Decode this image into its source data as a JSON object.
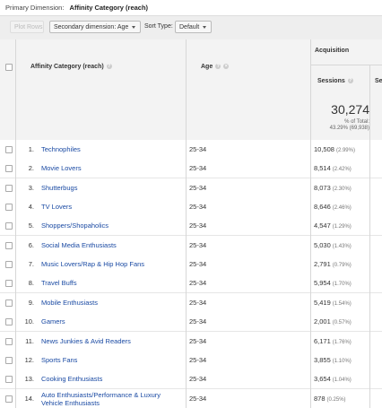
{
  "primary_dimension": {
    "label": "Primary Dimension:",
    "value": "Affinity Category (reach)"
  },
  "toolbar": {
    "plot_rows": "Plot Rows",
    "secondary_dimension": "Secondary dimension: Age",
    "sort_type_label": "Sort Type:",
    "sort_type_value": "Default"
  },
  "table": {
    "group_header": "Acquisition",
    "col_category": "Affinity Category (reach)",
    "col_age": "Age",
    "col_sessions": "Sessions",
    "col_next_partial": "Se",
    "total": {
      "value": "30,274",
      "pct_label": "% of Total:",
      "pct_value": "43.29% (69,938)"
    },
    "rows": [
      {
        "rank": "1.",
        "category": "Technophiles",
        "age": "25-34",
        "sessions": "10,508",
        "pct": "(2.99%)"
      },
      {
        "rank": "2.",
        "category": "Movie Lovers",
        "age": "25-34",
        "sessions": "8,514",
        "pct": "(2.42%)"
      },
      {
        "rank": "3.",
        "category": "Shutterbugs",
        "age": "25-34",
        "sessions": "8,073",
        "pct": "(2.30%)"
      },
      {
        "rank": "4.",
        "category": "TV Lovers",
        "age": "25-34",
        "sessions": "8,646",
        "pct": "(2.46%)"
      },
      {
        "rank": "5.",
        "category": "Shoppers/Shopaholics",
        "age": "25-34",
        "sessions": "4,547",
        "pct": "(1.29%)"
      },
      {
        "rank": "6.",
        "category": "Social Media Enthusiasts",
        "age": "25-34",
        "sessions": "5,030",
        "pct": "(1.43%)"
      },
      {
        "rank": "7.",
        "category": "Music Lovers/Rap & Hip Hop Fans",
        "age": "25-34",
        "sessions": "2,791",
        "pct": "(0.79%)"
      },
      {
        "rank": "8.",
        "category": "Travel Buffs",
        "age": "25-34",
        "sessions": "5,954",
        "pct": "(1.70%)"
      },
      {
        "rank": "9.",
        "category": "Mobile Enthusiasts",
        "age": "25-34",
        "sessions": "5,419",
        "pct": "(1.54%)"
      },
      {
        "rank": "10.",
        "category": "Gamers",
        "age": "25-34",
        "sessions": "2,001",
        "pct": "(0.57%)"
      },
      {
        "rank": "11.",
        "category": "News Junkies & Avid Readers",
        "age": "25-34",
        "sessions": "6,171",
        "pct": "(1.76%)"
      },
      {
        "rank": "12.",
        "category": "Sports Fans",
        "age": "25-34",
        "sessions": "3,855",
        "pct": "(1.10%)"
      },
      {
        "rank": "13.",
        "category": "Cooking Enthusiasts",
        "age": "25-34",
        "sessions": "3,654",
        "pct": "(1.04%)"
      },
      {
        "rank": "14.",
        "category": "Auto Enthusiasts/Performance & Luxury Vehicle Enthusiasts",
        "age": "25-34",
        "sessions": "878",
        "pct": "(0.25%)"
      }
    ]
  }
}
